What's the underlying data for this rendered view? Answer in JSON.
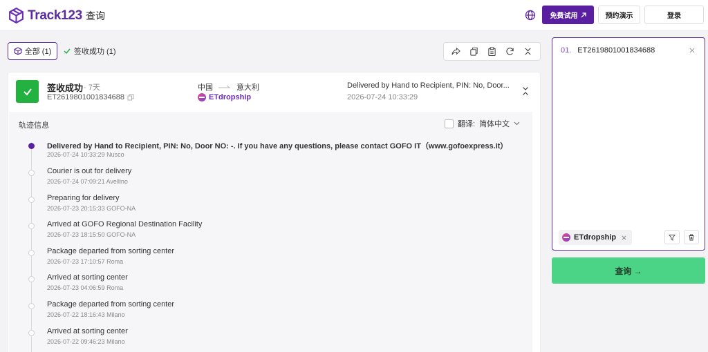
{
  "header": {
    "logo_text": "Track123",
    "page_title": "查询",
    "trial_label": "免费试用",
    "demo_label": "预约演示",
    "login_label": "登录"
  },
  "filters": {
    "all_label": "全部 (1)",
    "delivered_label": "签收成功 (1)"
  },
  "shipment": {
    "status": "签收成功",
    "days": "· 7天",
    "tracking_number": "ET2619801001834688",
    "origin": "中国",
    "destination": "意大利",
    "carrier": "ETdropship",
    "latest_event": "Delivered by Hand to Recipient, PIN: No, Door...",
    "latest_time": "2026-07-24 10:33:29"
  },
  "tracking": {
    "label": "轨迹信息",
    "translate_label": "翻译:",
    "translate_lang": "简体中文",
    "events": [
      {
        "desc": "Delivered by Hand to Recipient, PIN: No, Door NO: -. If you have any questions, please contact GOFO IT（www.gofoexpress.it）",
        "meta": "2026-07-24 10:33:29 Nusco"
      },
      {
        "desc": "Courier is out for delivery",
        "meta": "2026-07-24 07:09:21 Avellino"
      },
      {
        "desc": "Preparing for delivery",
        "meta": "2026-07-23 20:15:33 GOFO-NA"
      },
      {
        "desc": "Arrived at GOFO Regional Destination Facility",
        "meta": "2026-07-23 18:15:50 GOFO-NA"
      },
      {
        "desc": "Package departed from sorting center",
        "meta": "2026-07-23 17:10:57 Roma"
      },
      {
        "desc": "Arrived at sorting center",
        "meta": "2026-07-23 04:06:59 Roma"
      },
      {
        "desc": "Package departed from sorting center",
        "meta": "2026-07-22 18:16:43 Milano"
      },
      {
        "desc": "Arrived at sorting center",
        "meta": "2026-07-22 09:46:23 Milano"
      }
    ]
  },
  "query_panel": {
    "index": "01.",
    "input_value": "ET2619801001834688",
    "carrier_chip": "ETdropship",
    "query_label": "查询 →"
  }
}
